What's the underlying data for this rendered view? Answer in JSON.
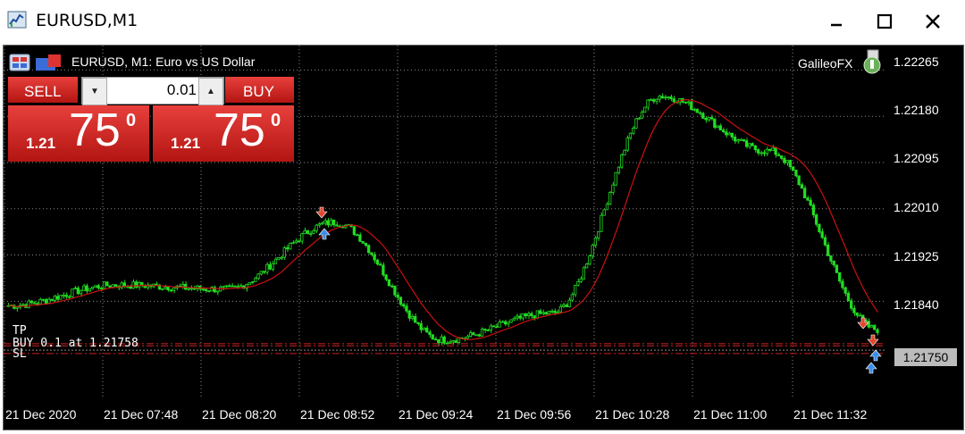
{
  "window": {
    "title": "EURUSD,M1",
    "buttons": [
      "minimize",
      "maximize",
      "close"
    ]
  },
  "chart_header": {
    "symbol_desc": "EURUSD, M1:  Euro vs US Dollar",
    "expert_name": "GalileoFX"
  },
  "trade_panel": {
    "sell_label": "SELL",
    "buy_label": "BUY",
    "lot_value": "0.01",
    "sell_price": {
      "small": "1.21",
      "big": "75",
      "sup": "0"
    },
    "buy_price": {
      "small": "1.21",
      "big": "75",
      "sup": "0"
    }
  },
  "price_axis": {
    "ticks": [
      "1.22265",
      "1.22180",
      "1.22095",
      "1.22010",
      "1.21925",
      "1.21840"
    ],
    "current_price": "1.21750"
  },
  "time_axis": {
    "ticks": [
      "21 Dec 2020",
      "21 Dec 07:48",
      "21 Dec 08:20",
      "21 Dec 08:52",
      "21 Dec 09:24",
      "21 Dec 09:56",
      "21 Dec 10:28",
      "21 Dec 11:00",
      "21 Dec 11:32"
    ]
  },
  "order_lines": {
    "tp_label": "TP",
    "entry_label": "BUY 0.1 at 1.21758",
    "sl_label": "SL"
  },
  "colors": {
    "background": "#000000",
    "candles": "#22dd22",
    "moving_average": "#cc1111",
    "sell_button": "#d42622",
    "buy_button": "#d42622",
    "order_line": "#cc2222"
  },
  "chart_data": {
    "type": "line",
    "title": "EURUSD, M1:  Euro vs US Dollar",
    "x": [
      "21 Dec 2020",
      "21 Dec 07:48",
      "21 Dec 08:20",
      "21 Dec 08:52",
      "21 Dec 09:24",
      "21 Dec 09:56",
      "21 Dec 10:28",
      "21 Dec 11:00",
      "21 Dec 11:32"
    ],
    "series": [
      {
        "values": [
          1.21832,
          1.2187,
          1.21862,
          1.21985,
          1.21769,
          1.21818,
          1.22217,
          1.22116,
          1.21788
        ]
      }
    ],
    "ylim": [
      1.2166,
      1.2231
    ],
    "grid": true
  }
}
